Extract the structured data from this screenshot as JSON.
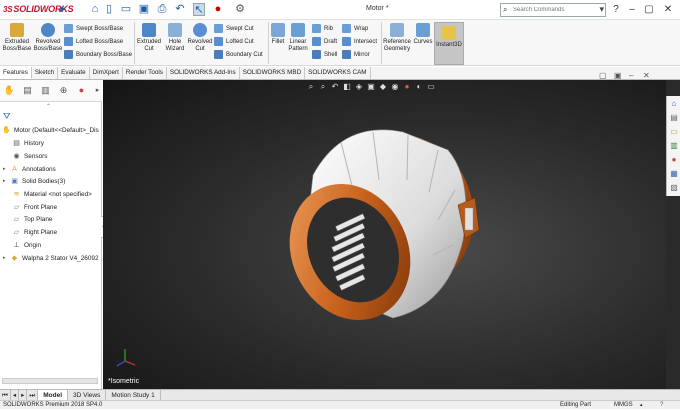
{
  "titlebar": {
    "logo": "SOLIDWORKS",
    "window_title": "Motor *",
    "search_placeholder": "Search Commands",
    "window_controls": [
      "help-icon",
      "minimize-icon",
      "restore-icon",
      "close-icon"
    ]
  },
  "ribbon": {
    "extruded_boss": "Extruded Boss/Base",
    "revolved_boss": "Revolved Boss/Base",
    "swept_boss": "Swept Boss/Base",
    "lofted_boss": "Lofted Boss/Base",
    "boundary_boss": "Boundary Boss/Base",
    "extruded_cut": "Extruded Cut",
    "hole_wizard": "Hole Wizard",
    "revolved_cut": "Revolved Cut",
    "swept_cut": "Swept Cut",
    "lofted_cut": "Lofted Cut",
    "boundary_cut": "Boundary Cut",
    "fillet": "Fillet",
    "linear_pattern": "Linear Pattern",
    "rib": "Rib",
    "draft": "Draft",
    "shell": "Shell",
    "wrap": "Wrap",
    "intersect": "Intersect",
    "mirror": "Mirror",
    "reference_geometry": "Reference Geometry",
    "curves": "Curves",
    "instant3d": "Instant3D"
  },
  "tabs": [
    "Features",
    "Sketch",
    "Evaluate",
    "DimXpert",
    "Render Tools",
    "SOLIDWORKS Add-Ins",
    "SOLIDWORKS MBD",
    "SOLIDWORKS CAM"
  ],
  "tree": {
    "root": "Motor  (Default<<Default>_Dis",
    "items": [
      "History",
      "Sensors",
      "Annotations",
      "Solid Bodies(3)",
      "Material <not specified>",
      "Front Plane",
      "Top Plane",
      "Right Plane",
      "Origin",
      "Walpha 2 Stator V4_26092"
    ]
  },
  "viewport": {
    "view_label": "*Isometric"
  },
  "bottom_tabs": [
    "Model",
    "3D Views",
    "Motion Study 1"
  ],
  "status": {
    "version": "SOLIDWORKS Premium 2018 SP4.0",
    "mode": "Editing Part",
    "units": "MMGS"
  },
  "colors": {
    "accent": "#1e5aa8",
    "copper": "#d2691e",
    "brand_red": "#c8102e"
  }
}
